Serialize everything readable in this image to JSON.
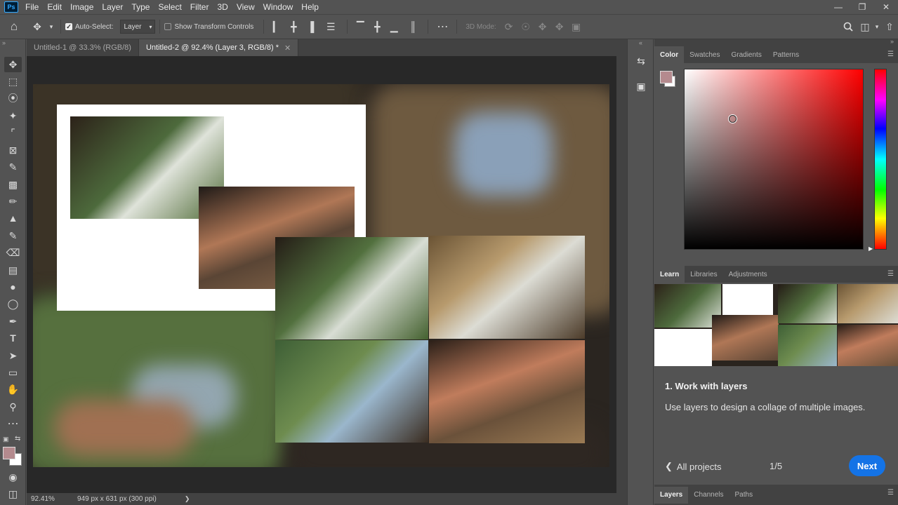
{
  "menubar": {
    "logo": "Ps",
    "items": [
      "File",
      "Edit",
      "Image",
      "Layer",
      "Type",
      "Select",
      "Filter",
      "3D",
      "View",
      "Window",
      "Help"
    ]
  },
  "options_bar": {
    "auto_select_label": "Auto-Select:",
    "auto_select_checked": true,
    "auto_select_target": "Layer",
    "show_transform_label": "Show Transform Controls",
    "show_transform_checked": false,
    "mode_3d_label": "3D Mode:"
  },
  "doc_tabs": [
    {
      "label": "Untitled-1 @ 33.3% (RGB/8)",
      "active": false
    },
    {
      "label": "Untitled-2 @ 92.4% (Layer 3, RGB/8) *",
      "active": true
    }
  ],
  "status": {
    "zoom": "92.41%",
    "doc_info": "949 px x 631 px (300 ppi)"
  },
  "color_panel": {
    "tabs": [
      "Color",
      "Swatches",
      "Gradients",
      "Patterns"
    ],
    "active_tab": "Color",
    "foreground_color": "#b48a8e",
    "background_color": "#ffffff",
    "hue_color": "#ff0000"
  },
  "learn_panel": {
    "tabs": [
      "Learn",
      "Libraries",
      "Adjustments"
    ],
    "active_tab": "Learn",
    "step_title": "1.  Work with layers",
    "step_desc": "Use layers to design a collage of multiple images.",
    "back_label": "All projects",
    "progress": "1/5",
    "next_label": "Next"
  },
  "layers_panel": {
    "tabs": [
      "Layers",
      "Channels",
      "Paths"
    ],
    "active_tab": "Layers"
  }
}
